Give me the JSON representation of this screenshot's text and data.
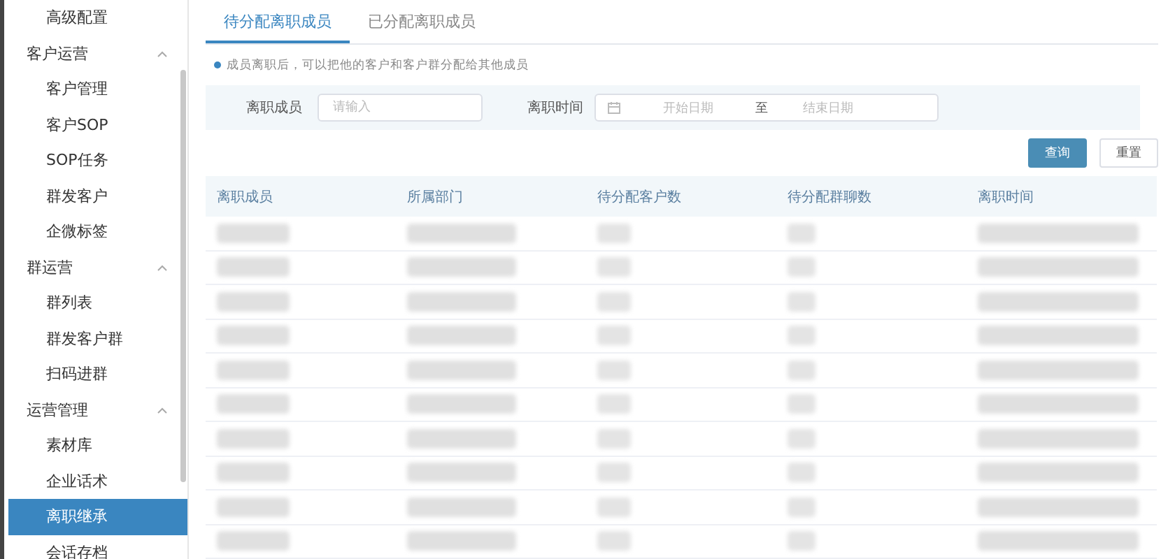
{
  "sidebar": {
    "items": [
      {
        "label": "高级配置",
        "kind": "item",
        "selected": false
      },
      {
        "label": "客户运营",
        "kind": "group",
        "expanded": true,
        "selected": false
      },
      {
        "label": "客户管理",
        "kind": "item",
        "selected": false
      },
      {
        "label": "客户SOP",
        "kind": "item",
        "selected": false
      },
      {
        "label": "SOP任务",
        "kind": "item",
        "selected": false
      },
      {
        "label": "群发客户",
        "kind": "item",
        "selected": false
      },
      {
        "label": "企微标签",
        "kind": "item",
        "selected": false
      },
      {
        "label": "群运营",
        "kind": "group",
        "expanded": true,
        "selected": false
      },
      {
        "label": "群列表",
        "kind": "item",
        "selected": false
      },
      {
        "label": "群发客户群",
        "kind": "item",
        "selected": false
      },
      {
        "label": "扫码进群",
        "kind": "item",
        "selected": false
      },
      {
        "label": "运营管理",
        "kind": "group",
        "expanded": true,
        "selected": false
      },
      {
        "label": "素材库",
        "kind": "item",
        "selected": false
      },
      {
        "label": "企业话术",
        "kind": "item",
        "selected": false
      },
      {
        "label": "离职继承",
        "kind": "item",
        "selected": true
      },
      {
        "label": "会话存档",
        "kind": "item",
        "selected": false
      }
    ]
  },
  "tabs": [
    {
      "label": "待分配离职成员",
      "selected": true
    },
    {
      "label": "已分配离职成员",
      "selected": false
    }
  ],
  "hint": "成员离职后，可以把他的客户和客户群分配给其他成员",
  "filter": {
    "member_label": "离职成员",
    "member_placeholder": "请输入",
    "time_label": "离职时间",
    "start_placeholder": "开始日期",
    "separator": "至",
    "end_placeholder": "结束日期"
  },
  "buttons": {
    "search": "查询",
    "reset": "重置"
  },
  "table": {
    "columns": [
      "离职成员",
      "所属部门",
      "待分配客户数",
      "待分配群聊数",
      "离职时间"
    ],
    "rows": [
      {
        "blurred": true
      },
      {
        "blurred": true
      },
      {
        "blurred": true
      },
      {
        "blurred": true
      },
      {
        "blurred": true
      },
      {
        "blurred": true
      },
      {
        "blurred": true
      },
      {
        "blurred": true
      },
      {
        "blurred": true
      },
      {
        "blurred": true
      }
    ]
  }
}
